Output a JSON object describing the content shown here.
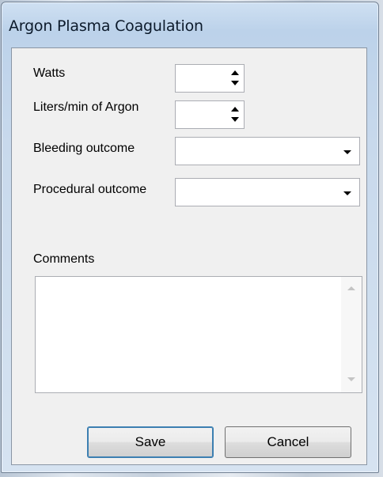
{
  "window": {
    "title": "Argon Plasma Coagulation"
  },
  "form": {
    "watts_label": "Watts",
    "watts_value": "",
    "argon_label": "Liters/min of Argon",
    "argon_value": "",
    "bleeding_label": "Bleeding outcome",
    "bleeding_value": "",
    "procedural_label": "Procedural outcome",
    "procedural_value": "",
    "comments_label": "Comments",
    "comments_value": ""
  },
  "buttons": {
    "save": "Save",
    "cancel": "Cancel"
  }
}
